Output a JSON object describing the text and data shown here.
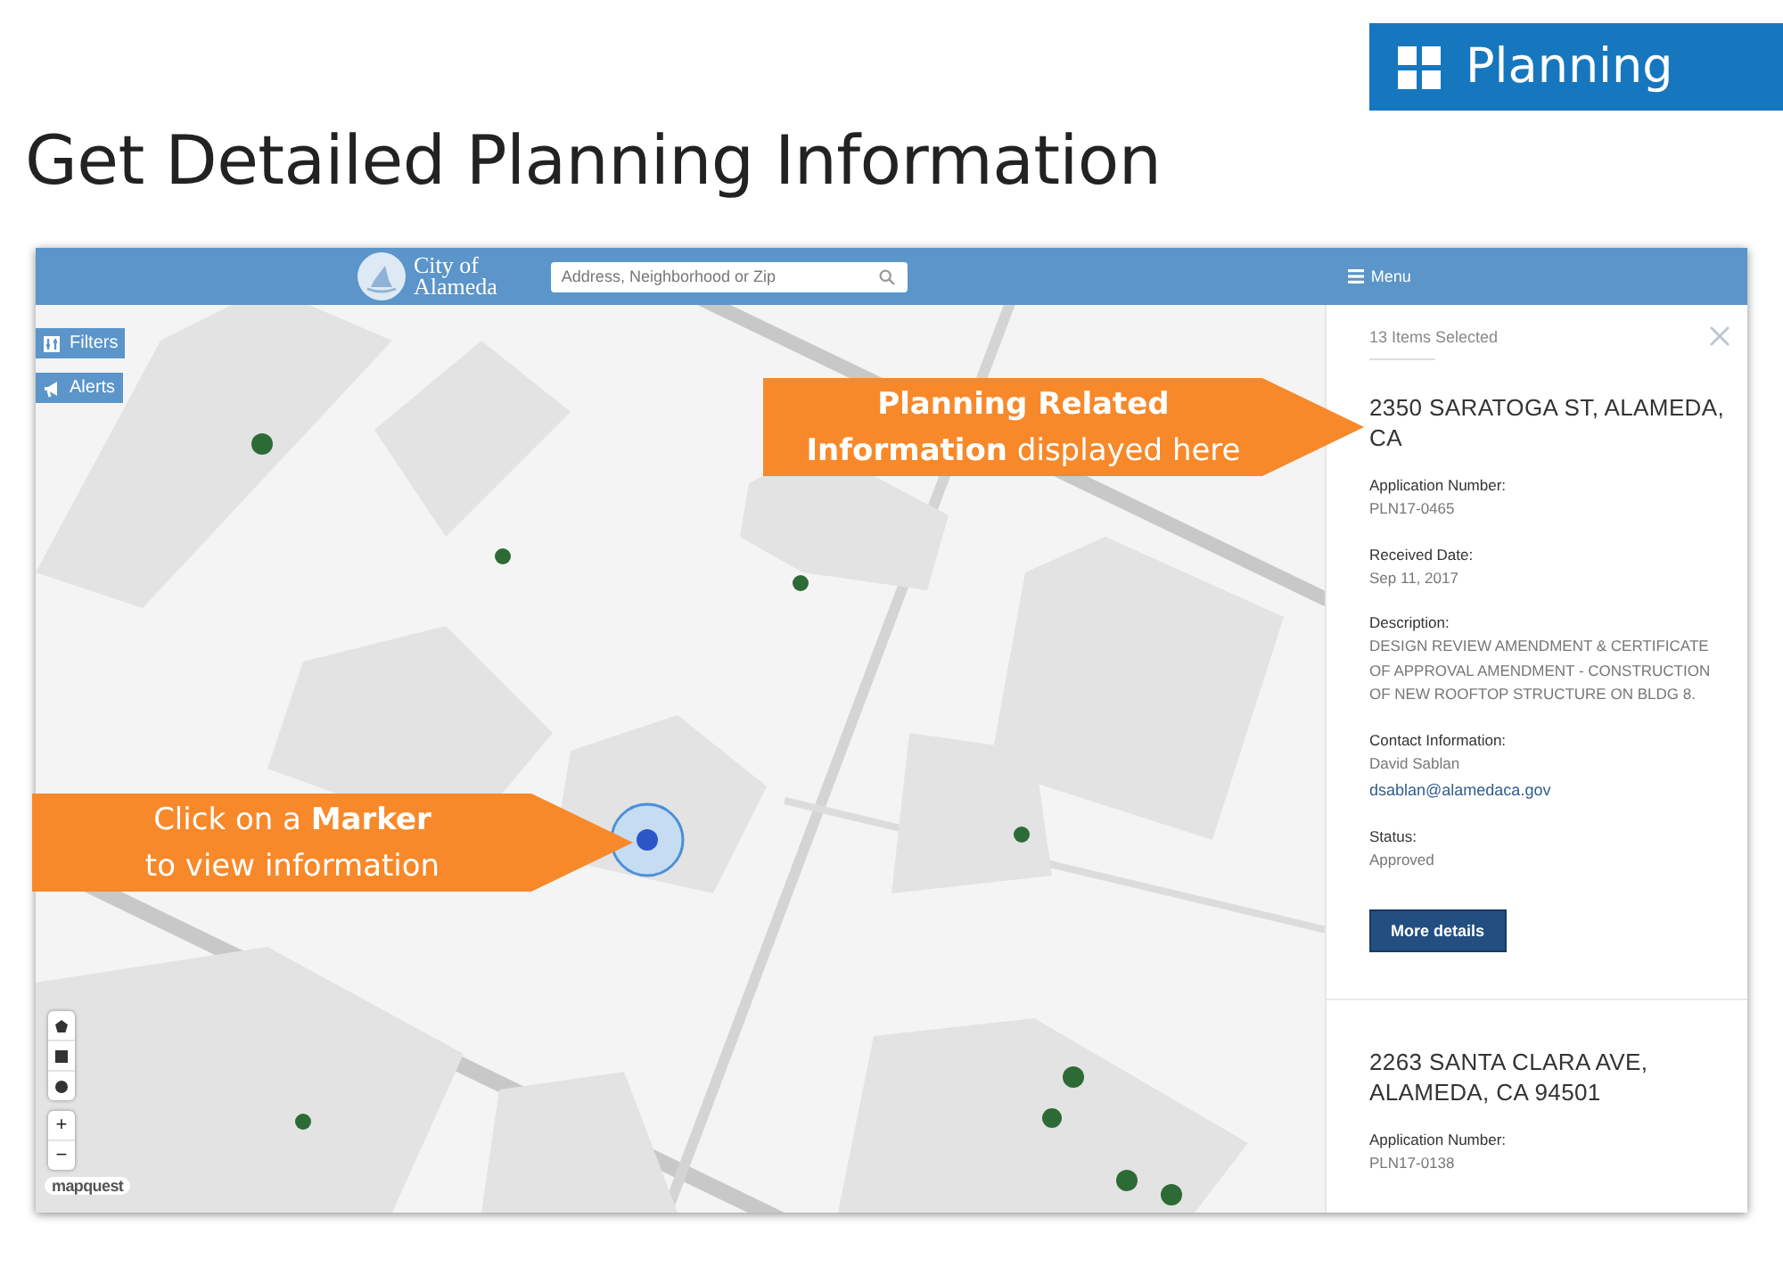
{
  "header_badge": {
    "label": "Planning"
  },
  "title": "Get Detailed Planning Information",
  "app": {
    "brand_lines": [
      "City of",
      "Alameda"
    ],
    "search": {
      "placeholder": "Address, Neighborhood or Zip"
    },
    "menu": {
      "label": "Menu"
    },
    "map": {
      "buttons": [
        {
          "label": "Filters",
          "kind": "filters"
        },
        {
          "label": "Alerts",
          "kind": "alerts"
        }
      ],
      "draw_tools": [
        {
          "kind": "polygon"
        },
        {
          "kind": "square"
        },
        {
          "kind": "circle"
        }
      ],
      "zoom": [
        {
          "label": "+"
        },
        {
          "label": "−"
        }
      ],
      "attribution": "mapquest"
    },
    "panel": {
      "selection_count": "13 Items Selected",
      "results": [
        {
          "address": "2350 SARATOGA ST, ALAMEDA, CA",
          "fields": [
            {
              "label": "Application Number:",
              "values": [
                {
                  "text": "PLN17-0465"
                }
              ]
            },
            {
              "label": "Received Date:",
              "values": [
                {
                  "text": "Sep 11, 2017"
                }
              ]
            },
            {
              "label": "Description:",
              "values": [
                {
                  "text": "DESIGN REVIEW AMENDMENT & CERTIFICATE OF APPROVAL AMENDMENT - CONSTRUCTION OF NEW ROOFTOP STRUCTURE ON BLDG 8."
                }
              ]
            },
            {
              "label": "Contact Information:",
              "values": [
                {
                  "text": "David Sablan"
                },
                {
                  "text": "dsablan@alamedaca.gov",
                  "kind": "link"
                }
              ]
            },
            {
              "label": "Status:",
              "values": [
                {
                  "text": "Approved"
                }
              ]
            }
          ],
          "button": "More details"
        },
        {
          "address": "2263 SANTA CLARA AVE, ALAMEDA, CA 94501",
          "fields": [
            {
              "label": "Application Number:",
              "values": [
                {
                  "text": "PLN17-0138"
                }
              ]
            }
          ]
        }
      ]
    }
  },
  "callouts": [
    {
      "lines": [
        "**Planning Related**",
        "**Information** displayed here"
      ]
    },
    {
      "lines": [
        "Click on a **Marker**",
        "to view information"
      ]
    }
  ]
}
